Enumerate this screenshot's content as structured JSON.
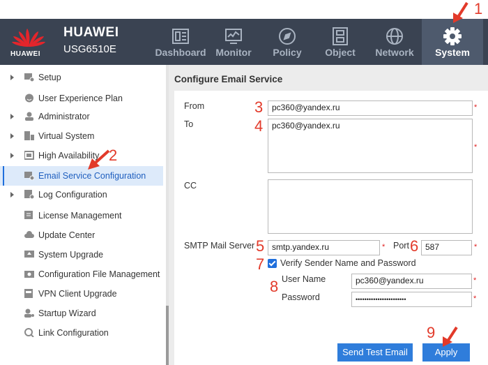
{
  "brand": {
    "logo_text": "HUAWEI",
    "name": "HUAWEI",
    "model": "USG6510E"
  },
  "nav": [
    {
      "label": "Dashboard",
      "icon": "dashboard-icon"
    },
    {
      "label": "Monitor",
      "icon": "monitor-icon"
    },
    {
      "label": "Policy",
      "icon": "compass-icon"
    },
    {
      "label": "Object",
      "icon": "object-icon"
    },
    {
      "label": "Network",
      "icon": "globe-icon"
    },
    {
      "label": "System",
      "icon": "gear-icon",
      "active": true
    }
  ],
  "sidebar": {
    "items": [
      {
        "label": "Setup",
        "expandable": true,
        "icon": "setup-icon"
      },
      {
        "label": "User Experience Plan",
        "expandable": false,
        "icon": "smiley-icon"
      },
      {
        "label": "Administrator",
        "expandable": true,
        "icon": "user-icon"
      },
      {
        "label": "Virtual System",
        "expandable": true,
        "icon": "virtual-system-icon"
      },
      {
        "label": "High Availability",
        "expandable": true,
        "icon": "ha-icon"
      },
      {
        "label": "Email Service Configuration",
        "expandable": false,
        "icon": "email-gear-icon",
        "selected": true
      },
      {
        "label": "Log Configuration",
        "expandable": true,
        "icon": "log-icon"
      },
      {
        "label": "License Management",
        "expandable": false,
        "icon": "license-icon"
      },
      {
        "label": "Update Center",
        "expandable": false,
        "icon": "cloud-icon"
      },
      {
        "label": "System Upgrade",
        "expandable": false,
        "icon": "upgrade-icon"
      },
      {
        "label": "Configuration File Management",
        "expandable": false,
        "icon": "config-file-icon"
      },
      {
        "label": "VPN Client Upgrade",
        "expandable": false,
        "icon": "vpn-icon"
      },
      {
        "label": "Startup Wizard",
        "expandable": false,
        "icon": "wizard-icon"
      },
      {
        "label": "Link Configuration",
        "expandable": false,
        "icon": "link-icon"
      }
    ]
  },
  "form": {
    "title": "Configure Email Service",
    "from_label": "From",
    "from_value": "pc360@yandex.ru",
    "to_label": "To",
    "to_value": "pc360@yandex.ru",
    "cc_label": "CC",
    "cc_value": "",
    "smtp_label": "SMTP Mail Server",
    "smtp_value": "smtp.yandex.ru",
    "port_label": "Port",
    "port_value": "587",
    "verify_label": "Verify Sender Name and Password",
    "verify_checked": true,
    "username_label": "User Name",
    "username_value": "pc360@yandex.ru",
    "password_label": "Password",
    "password_value": "•••••••••••••••••••••••",
    "required_mark": "*"
  },
  "buttons": {
    "send_test": "Send Test Email",
    "apply": "Apply"
  },
  "annotations": [
    "1",
    "2",
    "3",
    "4",
    "5",
    "6",
    "7",
    "8",
    "9"
  ],
  "colors": {
    "header_bg": "#3a4352",
    "active_nav": "#4e5a6d",
    "accent": "#2f7ddb",
    "annotation": "#e23a2a",
    "selected_bg": "#ddeafa"
  }
}
